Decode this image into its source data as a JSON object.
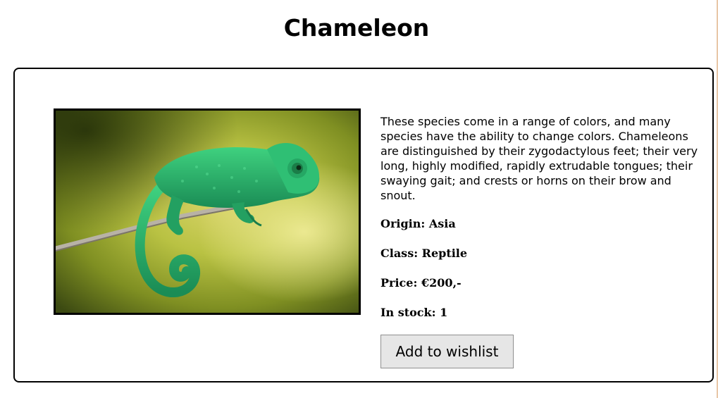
{
  "page": {
    "title": "Chameleon"
  },
  "product": {
    "image_alt": "Green chameleon perched on a branch",
    "description": "These species come in a range of colors, and many species have the ability to change colors. Chameleons are distinguished by their zygodactylous feet; their very long, highly modified, rapidly extrudable tongues; their swaying gait; and crests or horns on their brow and snout.",
    "origin": "Origin: Asia",
    "class": "Class: Reptile",
    "price": "Price: €200,-",
    "stock": "In stock: 1",
    "wishlist_label": "Add to wishlist"
  },
  "colors": {
    "button_bg": "#e6e6e6",
    "border": "#000000",
    "chameleon_green": "#2fae6a"
  }
}
